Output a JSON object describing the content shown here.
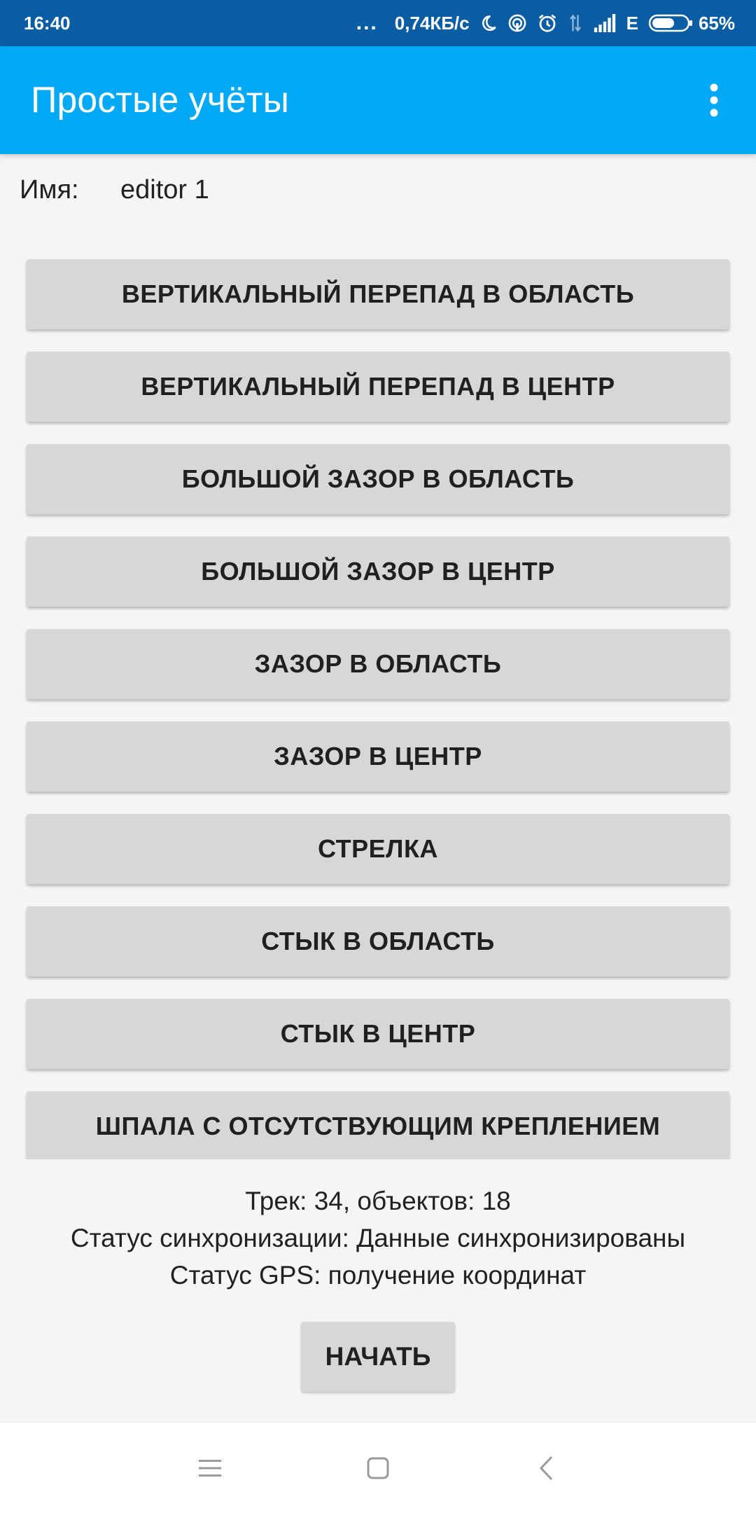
{
  "status_bar": {
    "time": "16:40",
    "dots": "...",
    "net_speed": "0,74КБ/с",
    "network_type": "E",
    "battery_percent": "65%",
    "battery_level": 0.65,
    "icons": [
      "moon-icon",
      "hotspot-icon",
      "alarm-icon",
      "data-arrows-icon",
      "signal-icon",
      "battery-icon"
    ],
    "background_color": "#0b5da3"
  },
  "app_bar": {
    "title": "Простые учёты",
    "overflow_icon": "more-vert-icon",
    "background_color": "#03a9f4"
  },
  "user": {
    "label": "Имя:",
    "value": "editor 1"
  },
  "buttons": [
    {
      "label": "ВЕРТИКАЛЬНЫЙ ПЕРЕПАД В ОБЛАСТЬ"
    },
    {
      "label": "ВЕРТИКАЛЬНЫЙ ПЕРЕПАД В ЦЕНТР"
    },
    {
      "label": "БОЛЬШОЙ ЗАЗОР В ОБЛАСТЬ"
    },
    {
      "label": "БОЛЬШОЙ ЗАЗОР В ЦЕНТР"
    },
    {
      "label": "ЗАЗОР В ОБЛАСТЬ"
    },
    {
      "label": "ЗАЗОР В ЦЕНТР"
    },
    {
      "label": "СТРЕЛКА"
    },
    {
      "label": "СТЫК В ОБЛАСТЬ"
    },
    {
      "label": "СТЫК В ЦЕНТР"
    },
    {
      "label": "ШПАЛА С ОТСУТСТВУЮЩИМ КРЕПЛЕНИЕМ"
    }
  ],
  "info": {
    "track_line": "Трек: 34, объектов: 18",
    "sync_status": "Статус синхронизации: Данные синхронизированы",
    "gps_status": "Статус GPS: получение координат"
  },
  "start_button": {
    "label": "НАЧАТЬ"
  },
  "nav_bar": {
    "icons": [
      "menu-icon",
      "home-square-icon",
      "back-chevron-icon"
    ]
  }
}
